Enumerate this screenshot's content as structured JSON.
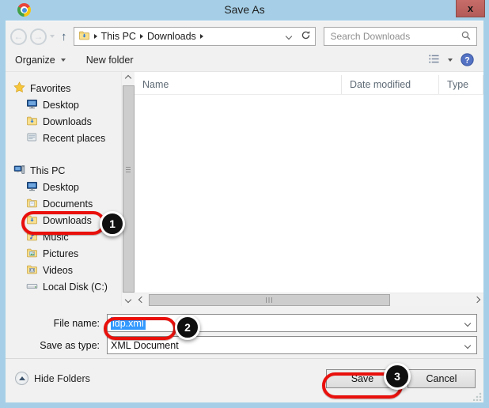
{
  "window": {
    "title": "Save As",
    "close_glyph": "x"
  },
  "icons": {
    "back_arrow": "←",
    "forward_arrow": "→",
    "up_arrow": "↑",
    "help_glyph": "?"
  },
  "navbar": {
    "breadcrumb": [
      "This PC",
      "Downloads"
    ],
    "search_placeholder": "Search Downloads"
  },
  "toolbar": {
    "organize_label": "Organize",
    "new_folder_label": "New folder"
  },
  "sidebar": {
    "groups": [
      {
        "label": "Favorites",
        "icon": "star-icon",
        "items": [
          {
            "label": "Desktop",
            "icon": "desktop-icon"
          },
          {
            "label": "Downloads",
            "icon": "downloads-folder-icon"
          },
          {
            "label": "Recent places",
            "icon": "recent-places-icon"
          }
        ]
      },
      {
        "label": "This PC",
        "icon": "computer-icon",
        "items": [
          {
            "label": "Desktop",
            "icon": "desktop-folder-icon"
          },
          {
            "label": "Documents",
            "icon": "documents-folder-icon"
          },
          {
            "label": "Downloads",
            "icon": "downloads-folder-icon",
            "annotated_step": "1"
          },
          {
            "label": "Music",
            "icon": "music-folder-icon"
          },
          {
            "label": "Pictures",
            "icon": "pictures-folder-icon"
          },
          {
            "label": "Videos",
            "icon": "videos-folder-icon"
          },
          {
            "label": "Local Disk (C:)",
            "icon": "disk-drive-icon"
          }
        ]
      }
    ]
  },
  "file_list": {
    "columns": [
      "Name",
      "Date modified",
      "Type"
    ]
  },
  "fields": {
    "file_name": {
      "label": "File name:",
      "value": "idp.xml",
      "annotated_step": "2"
    },
    "save_as_type": {
      "label": "Save as type:",
      "value": "XML Document"
    }
  },
  "footer": {
    "hide_folders_label": "Hide Folders",
    "save_label": "Save",
    "cancel_label": "Cancel",
    "save_annotated_step": "3"
  },
  "annotations": {
    "color": "#e9100c",
    "steps": [
      "1",
      "2",
      "3"
    ]
  }
}
